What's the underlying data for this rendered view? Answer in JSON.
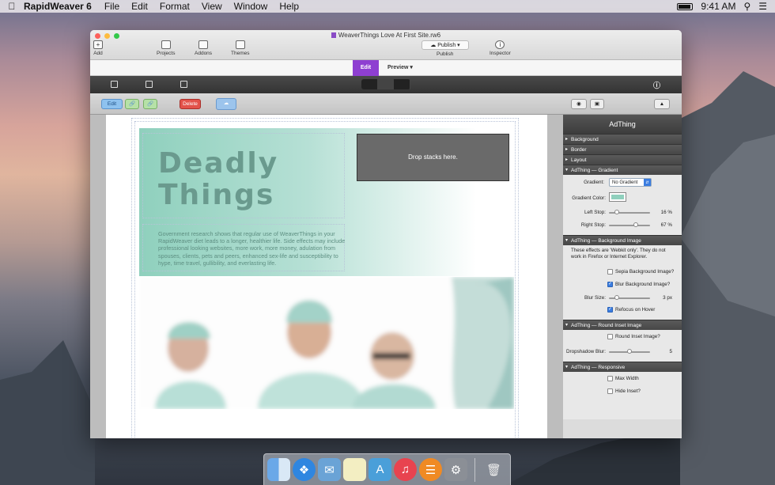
{
  "menubar": {
    "app": "RapidWeaver 6",
    "items": [
      "File",
      "Edit",
      "Format",
      "View",
      "Window",
      "Help"
    ],
    "clock": "9:41 AM"
  },
  "window": {
    "title": "WeaverThings Love At First Site.rw6"
  },
  "toolbar": {
    "add": "Add",
    "projects": "Projects",
    "addons": "Addons",
    "themes": "Themes",
    "publish": "Publish",
    "publish_label": "Publish",
    "inspector": "Inspector"
  },
  "modes": {
    "edit": "Edit",
    "preview": "Preview"
  },
  "stackbar": {
    "edit": "Edit",
    "delete": "Delete"
  },
  "page": {
    "headline1": "Deadly",
    "headline2": "Things",
    "body": "Government research shows that regular use of WeaverThings in your RapidWeaver diet leads to a longer, healthier life. Side effects may include professional looking websites, more work, more money, adulation from spouses, clients, pets and peers, enhanced sex-life and susceptibility to hype, time travel, gullibility, and everlasting life.",
    "drop": "Drop stacks here."
  },
  "inspector": {
    "title": "AdThing",
    "sections": [
      "Background",
      "Border",
      "Layout"
    ],
    "gradient": {
      "header": "AdThing — Gradient",
      "gradient_label": "Gradient:",
      "gradient_value": "No Gradient",
      "color_label": "Gradient Color:",
      "left_label": "Left Stop:",
      "left_value": "16 %",
      "left_level": 0.16,
      "right_label": "Right Stop:",
      "right_value": "67 %",
      "right_level": 0.67
    },
    "bgimage": {
      "header": "AdThing — Background Image",
      "note": "These effects are 'Webkit only'. They do not work in Firefox or Internet Explorer.",
      "sepia": "Sepia Background Image?",
      "sepia_checked": false,
      "blur": "Blur Background Image?",
      "blur_checked": true,
      "blur_size_label": "Blur Size:",
      "blur_size_value": "3 px",
      "blur_level": 0.15,
      "refocus": "Refocus on Hover",
      "refocus_checked": true
    },
    "inset": {
      "header": "AdThing — Round Inset Image",
      "round": "Round Inset Image?",
      "round_checked": false,
      "shadow_label": "Dropshadow Blur:",
      "shadow_value": "5",
      "shadow_level": 0.5
    },
    "responsive": {
      "header": "AdThing — Responsive",
      "maxwidth": "Max Width",
      "maxwidth_checked": false,
      "hide": "Hide Inset?",
      "hide_checked": false
    }
  },
  "colors": {
    "accent": "#8e3fd1",
    "edit_btn": "#7fb3e8",
    "delete_btn": "#d9443a",
    "hero_teal": "#8fd0bd"
  }
}
